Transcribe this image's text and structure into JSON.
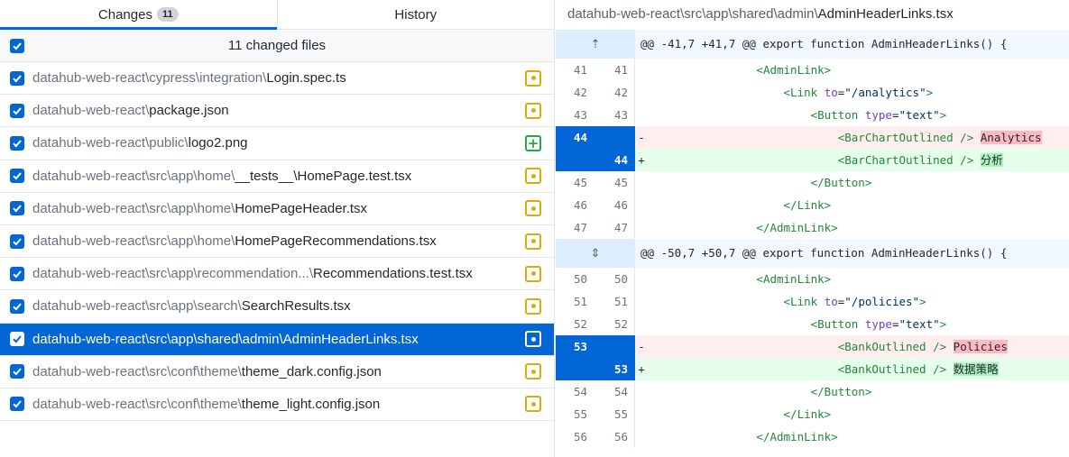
{
  "tabs": {
    "changes_label": "Changes",
    "changes_count": "11",
    "history_label": "History"
  },
  "changes_header": {
    "title": "11 changed files"
  },
  "files": [
    {
      "dir": "datahub-web-react\\cypress\\integration\\",
      "name": "Login.spec.ts",
      "status": "modified"
    },
    {
      "dir": "datahub-web-react\\",
      "name": "package.json",
      "status": "modified"
    },
    {
      "dir": "datahub-web-react\\public\\",
      "name": "logo2.png",
      "status": "added"
    },
    {
      "dir": "datahub-web-react\\src\\app\\home\\",
      "name": "__tests__\\HomePage.test.tsx",
      "status": "modified"
    },
    {
      "dir": "datahub-web-react\\src\\app\\home\\",
      "name": "HomePageHeader.tsx",
      "status": "modified"
    },
    {
      "dir": "datahub-web-react\\src\\app\\home\\",
      "name": "HomePageRecommendations.tsx",
      "status": "modified"
    },
    {
      "dir": "datahub-web-react\\src\\app\\recommendation...\\",
      "name": "Recommendations.test.tsx",
      "status": "modified"
    },
    {
      "dir": "datahub-web-react\\src\\app\\search\\",
      "name": "SearchResults.tsx",
      "status": "modified"
    },
    {
      "dir": "datahub-web-react\\src\\app\\shared\\admin\\",
      "name": "AdminHeaderLinks.tsx",
      "status": "modified",
      "selected": true
    },
    {
      "dir": "datahub-web-react\\src\\conf\\theme\\",
      "name": "theme_dark.config.json",
      "status": "modified"
    },
    {
      "dir": "datahub-web-react\\src\\conf\\theme\\",
      "name": "theme_light.config.json",
      "status": "modified"
    }
  ],
  "diff": {
    "path_dir": "datahub-web-react\\src\\app\\shared\\admin\\",
    "path_file": "AdminHeaderLinks.tsx",
    "rows": [
      {
        "type": "hunk",
        "text": "@@ -41,7 +41,7 @@ export function AdminHeaderLinks() {",
        "icon": "expand-up-icon"
      },
      {
        "type": "ctx",
        "old": "41",
        "new": "41",
        "indent": "                ",
        "html": "<span class='tag'>&lt;AdminLink&gt;</span>"
      },
      {
        "type": "ctx",
        "old": "42",
        "new": "42",
        "indent": "                    ",
        "html": "<span class='tag'>&lt;Link</span> <span class='attr'>to</span>=<span class='str'>\"/analytics\"</span><span class='tag'>&gt;</span>"
      },
      {
        "type": "ctx",
        "old": "43",
        "new": "43",
        "indent": "                        ",
        "html": "<span class='tag'>&lt;Button</span> <span class='attr'>type</span>=<span class='str'>\"text\"</span><span class='tag'>&gt;</span>"
      },
      {
        "type": "del",
        "old": "44",
        "new": "",
        "indent": "                            ",
        "html": "<span class='tag'>&lt;BarChartOutlined /&gt;</span> <span class='hl-del'>Analytics</span>"
      },
      {
        "type": "add",
        "old": "",
        "new": "44",
        "indent": "                            ",
        "html": "<span class='tag'>&lt;BarChartOutlined /&gt;</span> <span class='hl-add'>分析</span>"
      },
      {
        "type": "ctx",
        "old": "45",
        "new": "45",
        "indent": "                        ",
        "html": "<span class='tag'>&lt;/Button&gt;</span>"
      },
      {
        "type": "ctx",
        "old": "46",
        "new": "46",
        "indent": "                    ",
        "html": "<span class='tag'>&lt;/Link&gt;</span>"
      },
      {
        "type": "ctx",
        "old": "47",
        "new": "47",
        "indent": "                ",
        "html": "<span class='tag'>&lt;/AdminLink&gt;</span>"
      },
      {
        "type": "hunk",
        "text": "@@ -50,7 +50,7 @@ export function AdminHeaderLinks() {",
        "icon": "expand-both-icon"
      },
      {
        "type": "ctx",
        "old": "50",
        "new": "50",
        "indent": "                ",
        "html": "<span class='tag'>&lt;AdminLink&gt;</span>"
      },
      {
        "type": "ctx",
        "old": "51",
        "new": "51",
        "indent": "                    ",
        "html": "<span class='tag'>&lt;Link</span> <span class='attr'>to</span>=<span class='str'>\"/policies\"</span><span class='tag'>&gt;</span>"
      },
      {
        "type": "ctx",
        "old": "52",
        "new": "52",
        "indent": "                        ",
        "html": "<span class='tag'>&lt;Button</span> <span class='attr'>type</span>=<span class='str'>\"text\"</span><span class='tag'>&gt;</span>"
      },
      {
        "type": "del",
        "old": "53",
        "new": "",
        "indent": "                            ",
        "html": "<span class='tag'>&lt;BankOutlined /&gt;</span> <span class='hl-del'>Policies</span>"
      },
      {
        "type": "add",
        "old": "",
        "new": "53",
        "indent": "                            ",
        "html": "<span class='tag'>&lt;BankOutlined /&gt;</span> <span class='hl-add'>数据策略</span>"
      },
      {
        "type": "ctx",
        "old": "54",
        "new": "54",
        "indent": "                        ",
        "html": "<span class='tag'>&lt;/Button&gt;</span>"
      },
      {
        "type": "ctx",
        "old": "55",
        "new": "55",
        "indent": "                    ",
        "html": "<span class='tag'>&lt;/Link&gt;</span>"
      },
      {
        "type": "ctx",
        "old": "56",
        "new": "56",
        "indent": "                ",
        "html": "<span class='tag'>&lt;/AdminLink&gt;</span>"
      }
    ]
  },
  "colors": {
    "accent": "#0366d6",
    "modified": "#dbab09",
    "added": "#28a745",
    "del_bg": "#ffeef0",
    "add_bg": "#e6ffed"
  }
}
